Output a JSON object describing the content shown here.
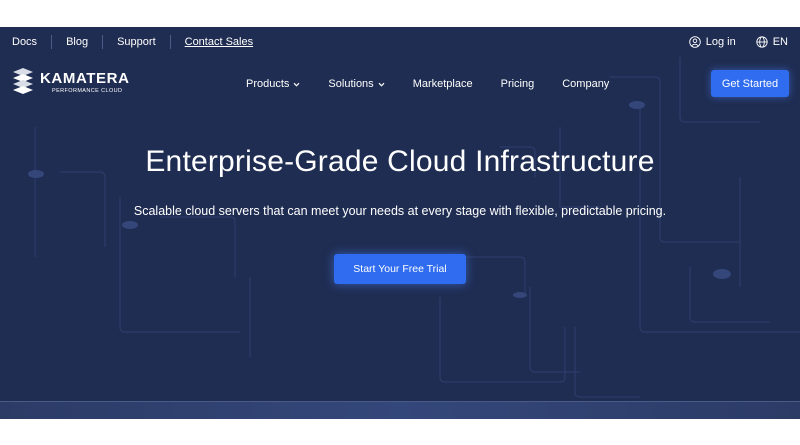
{
  "utility_bar": {
    "links": [
      "Docs",
      "Blog",
      "Support",
      "Contact Sales"
    ],
    "login_label": "Log in",
    "language_label": "EN",
    "icons": [
      "user-icon",
      "globe-icon"
    ]
  },
  "brand": {
    "name": "KAMATERA",
    "tagline": "PERFORMANCE CLOUD"
  },
  "nav": {
    "products": "Products",
    "solutions": "Solutions",
    "marketplace": "Marketplace",
    "pricing": "Pricing",
    "company": "Company",
    "get_started": "Get Started"
  },
  "hero": {
    "title": "Enterprise-Grade Cloud Infrastructure",
    "subtitle": "Scalable cloud servers that can meet your needs at every stage with flexible, predictable pricing.",
    "cta": "Start Your Free Trial"
  },
  "colors": {
    "background": "#1f2d52",
    "accent": "#2f6cf0",
    "text": "#ffffff"
  }
}
